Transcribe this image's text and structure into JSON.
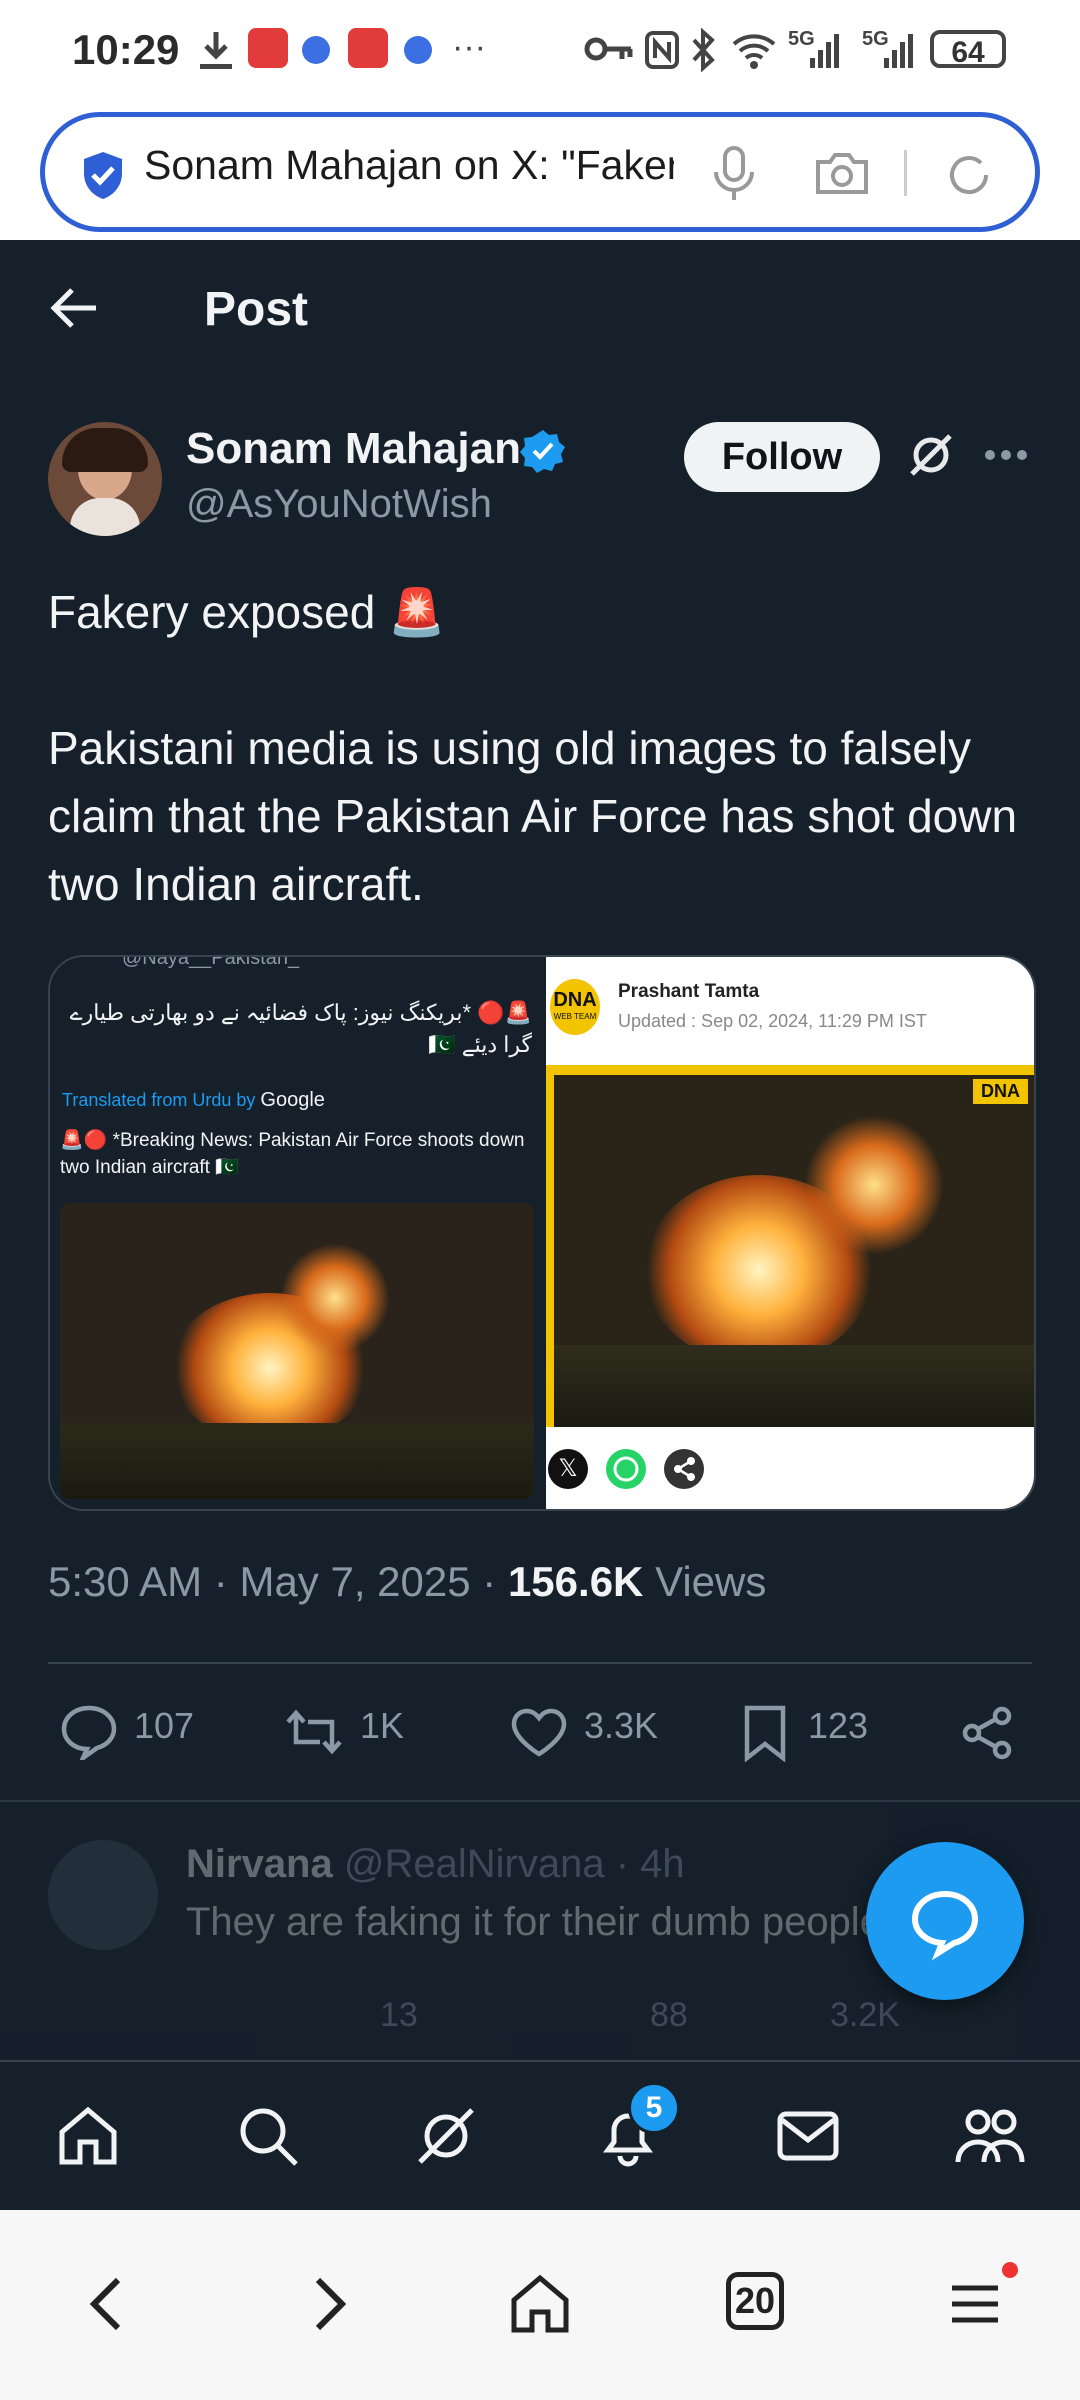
{
  "status_bar": {
    "time": "10:29",
    "network_1": "5G",
    "network_2": "5G",
    "battery": "64",
    "dots": "···"
  },
  "browser": {
    "url_text": "Sonam Mahajan on X: \"Fakery exposed",
    "tabs_count": "20"
  },
  "header": {
    "title": "Post"
  },
  "author": {
    "name": "Sonam Mahajan",
    "handle": "@AsYouNotWish",
    "follow_label": "Follow"
  },
  "post": {
    "line1": "Fakery exposed 🚨",
    "body": "Pakistani media is using old images to falsely claim that the Pakistan Air Force has shot down two Indian aircraft."
  },
  "media": {
    "left": {
      "top_handle": "@Naya__Pakistan_",
      "urdu_text": "🚨🔴 *بریکنگ نیوز: پاک فضائیہ نے دو بھارتی طیارے گرا دیئے 🇵🇰",
      "translated_prefix": "Translated from Urdu by",
      "translated_brand": "Google",
      "english_text": "🚨🔴 *Breaking News: Pakistan Air Force shoots down two Indian aircraft 🇵🇰"
    },
    "right": {
      "logo": "DNA",
      "logo_sub": "WEB TEAM",
      "author": "Prashant Tamta",
      "updated": "Updated : Sep 02, 2024, 11:29 PM IST",
      "watermark": "DNA"
    }
  },
  "meta": {
    "time": "5:30 AM",
    "date": "May 7, 2025",
    "views_count": "156.6K",
    "views_label": "Views",
    "separator": "·"
  },
  "actions": {
    "replies": "107",
    "reposts": "1K",
    "likes": "3.3K",
    "bookmarks": "123"
  },
  "reply_preview": {
    "name": "Nirvana",
    "handle": "@RealNirvana · 4h",
    "text": "They are faking it for their dumb people",
    "counts": [
      "",
      "13",
      "88",
      "3.2K",
      ""
    ]
  },
  "tab_bar": {
    "notifications_badge": "5"
  },
  "colors": {
    "background": "#15202b",
    "accent": "#1d9bf0",
    "secondary_text": "#8b98a5"
  }
}
